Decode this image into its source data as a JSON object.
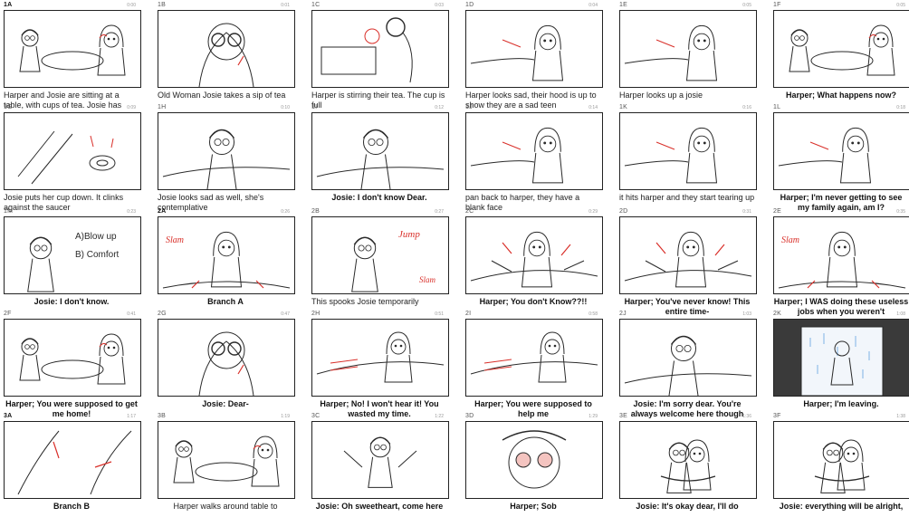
{
  "panels": [
    {
      "code": "1A",
      "time": "0:00",
      "caption": "Harper and Josie are sitting at a table, with cups of tea. Josie has",
      "style": "plain",
      "sketch": "table"
    },
    {
      "code": "1B",
      "time": "0:01",
      "caption": "Old Woman Josie takes a sip of tea",
      "style": "plain",
      "sketch": "closeup"
    },
    {
      "code": "1C",
      "time": "0:03",
      "caption": "Harper is stirring their tea. The cup is full",
      "style": "plain",
      "sketch": "stir"
    },
    {
      "code": "1D",
      "time": "0:04",
      "caption": "Harper looks sad, their hood is up to show they are a sad teen",
      "style": "plain",
      "sketch": "hood"
    },
    {
      "code": "1E",
      "time": "0:05",
      "caption": "Harper looks up a josie",
      "style": "plain",
      "sketch": "hood"
    },
    {
      "code": "1F",
      "time": "0:05",
      "caption": "Harper; What happens now?",
      "style": "dialog",
      "sketch": "table"
    },
    {
      "code": "1G",
      "time": "0:09",
      "caption": "Josie puts her cup down. It clinks against the saucer",
      "style": "plain",
      "sketch": "cup"
    },
    {
      "code": "1H",
      "time": "0:10",
      "caption": "Josie looks sad as well, she's contemplative",
      "style": "plain",
      "sketch": "josie"
    },
    {
      "code": "1I",
      "time": "0:12",
      "caption": "Josie: I don't know Dear.",
      "style": "dialog",
      "sketch": "josie"
    },
    {
      "code": "1J",
      "time": "0:14",
      "caption": "pan back to harper, they have a blank face",
      "style": "plain",
      "sketch": "hood"
    },
    {
      "code": "1K",
      "time": "0:16",
      "caption": "it hits harper and they start tearing up",
      "style": "plain",
      "sketch": "hood"
    },
    {
      "code": "1L",
      "time": "0:18",
      "caption": "Harper; I'm never getting to see my family again, am I?",
      "style": "dialog",
      "sketch": "hood"
    },
    {
      "code": "1M",
      "time": "0:23",
      "caption": "Josie: I don't know.",
      "style": "dialog",
      "sketch": "notes"
    },
    {
      "code": "2A",
      "time": "0:26",
      "caption": "Branch A",
      "style": "dialog",
      "sketch": "slam"
    },
    {
      "code": "2B",
      "time": "0:27",
      "caption": "This spooks Josie temporarily",
      "style": "plain",
      "sketch": "jump"
    },
    {
      "code": "2C",
      "time": "0:29",
      "caption": "Harper; You don't Know??!!",
      "style": "dialog",
      "sketch": "yell"
    },
    {
      "code": "2D",
      "time": "0:31",
      "caption": "Harper; You've never know! This entire time-",
      "style": "dialog",
      "sketch": "yell"
    },
    {
      "code": "2E",
      "time": "0:35",
      "caption": "Harper; I WAS doing these useless jobs when you weren't",
      "style": "dialog",
      "sketch": "slam"
    },
    {
      "code": "2F",
      "time": "0:41",
      "caption": "Harper; You were supposed to get me home!",
      "style": "dialog",
      "sketch": "table"
    },
    {
      "code": "2G",
      "time": "0:47",
      "caption": "Josie: Dear-",
      "style": "dialog",
      "sketch": "closeup"
    },
    {
      "code": "2H",
      "time": "0:51",
      "caption": "Harper; No! I won't hear it! You wasted my time.",
      "style": "dialog",
      "sketch": "walk"
    },
    {
      "code": "2I",
      "time": "0:58",
      "caption": "Harper; You were supposed to help me",
      "style": "dialog",
      "sketch": "walk"
    },
    {
      "code": "2J",
      "time": "1:03",
      "caption": "Josie: I'm sorry dear. You're always welcome here though",
      "style": "dialog",
      "sketch": "josie"
    },
    {
      "code": "2K",
      "time": "1:08",
      "caption": "Harper; I'm leaving.",
      "style": "dialog",
      "sketch": "door"
    },
    {
      "code": "3A",
      "time": "1:17",
      "caption": "Branch B",
      "style": "dialog",
      "sketch": "arms"
    },
    {
      "code": "3B",
      "time": "1:19",
      "caption": "Harper walks around table to",
      "style": "center",
      "sketch": "table"
    },
    {
      "code": "3C",
      "time": "1:22",
      "caption": "Josie: Oh sweetheart, come here",
      "style": "dialog",
      "sketch": "open"
    },
    {
      "code": "3D",
      "time": "1:29",
      "caption": "Harper; Sob",
      "style": "dialog",
      "sketch": "sob"
    },
    {
      "code": "3E",
      "time": "1:36",
      "caption": "Josie: It's okay dear, I'll do",
      "style": "dialog",
      "sketch": "hug"
    },
    {
      "code": "3F",
      "time": "1:38",
      "caption": "Josie: everything will be alright,",
      "style": "dialog",
      "sketch": "hug"
    }
  ],
  "notes": {
    "a": "A)Blow up",
    "b": "B) Comfort"
  },
  "sfx": {
    "jump": "Jump",
    "slam": "Slam",
    "slam2": "Slam"
  }
}
